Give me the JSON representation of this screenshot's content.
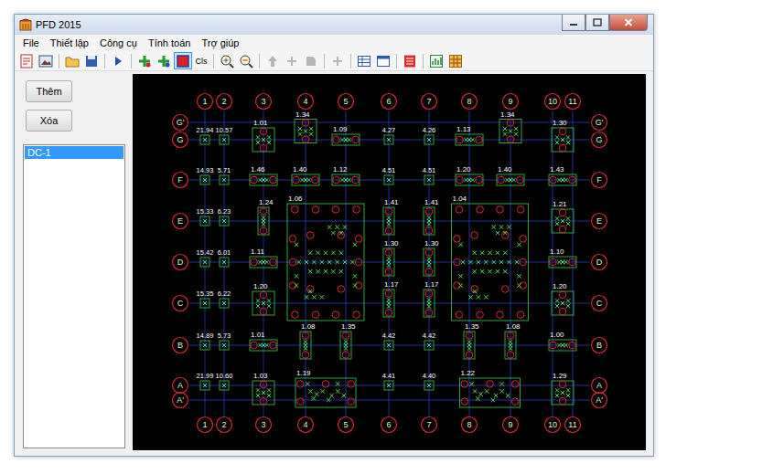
{
  "window": {
    "title": "PFD 2015"
  },
  "menu": [
    {
      "label": "File"
    },
    {
      "label": "Thiết lập"
    },
    {
      "label": "Công cụ"
    },
    {
      "label": "Tính toán"
    },
    {
      "label": "Trợ giúp"
    }
  ],
  "toolbar": [
    {
      "kind": "icon",
      "disabled": false,
      "selected": false
    },
    {
      "kind": "icon",
      "disabled": false,
      "selected": false
    },
    {
      "kind": "separator"
    },
    {
      "kind": "icon",
      "disabled": false,
      "selected": false
    },
    {
      "kind": "icon",
      "disabled": false,
      "selected": false
    },
    {
      "kind": "separator"
    },
    {
      "kind": "icon",
      "disabled": false,
      "selected": false
    },
    {
      "kind": "separator"
    },
    {
      "kind": "icon",
      "disabled": false,
      "selected": false
    },
    {
      "kind": "icon",
      "disabled": false,
      "selected": false
    },
    {
      "kind": "icon",
      "disabled": false,
      "selected": true
    },
    {
      "kind": "text",
      "label": "Cls",
      "disabled": false,
      "selected": false
    },
    {
      "kind": "separator"
    },
    {
      "kind": "icon",
      "disabled": false,
      "selected": false
    },
    {
      "kind": "icon",
      "disabled": false,
      "selected": false
    },
    {
      "kind": "separator"
    },
    {
      "kind": "icon",
      "disabled": true,
      "selected": false
    },
    {
      "kind": "icon",
      "disabled": true,
      "selected": false
    },
    {
      "kind": "icon",
      "disabled": true,
      "selected": false
    },
    {
      "kind": "separator"
    },
    {
      "kind": "icon",
      "disabled": true,
      "selected": false
    },
    {
      "kind": "separator"
    },
    {
      "kind": "icon",
      "disabled": false,
      "selected": false
    },
    {
      "kind": "icon",
      "disabled": false,
      "selected": false
    },
    {
      "kind": "separator"
    },
    {
      "kind": "icon",
      "disabled": false,
      "selected": false
    },
    {
      "kind": "separator"
    },
    {
      "kind": "icon",
      "disabled": false,
      "selected": false
    },
    {
      "kind": "icon",
      "disabled": false,
      "selected": false
    }
  ],
  "sidebar": {
    "buttons": [
      "Thêm",
      "Xóa"
    ],
    "items": [
      {
        "label": "DC-1",
        "selected": true
      }
    ]
  },
  "grid": {
    "columns": [
      {
        "label": "1"
      },
      {
        "label": "2"
      },
      {
        "label": "3"
      },
      {
        "label": "4"
      },
      {
        "label": "5"
      },
      {
        "label": "6"
      },
      {
        "label": "7"
      },
      {
        "label": "8"
      },
      {
        "label": "9"
      },
      {
        "label": "10"
      },
      {
        "label": "11"
      }
    ],
    "rows": [
      {
        "label": "G'"
      },
      {
        "label": "G"
      },
      {
        "label": "F"
      },
      {
        "label": "E"
      },
      {
        "label": "D"
      },
      {
        "label": "C"
      },
      {
        "label": "B"
      },
      {
        "label": "A"
      },
      {
        "label": "A'"
      }
    ]
  },
  "caps": [
    {
      "value": "21.94",
      "cols": [
        "1"
      ],
      "rows": [
        "G"
      ],
      "kind": "single"
    },
    {
      "value": "10.57",
      "cols": [
        "2"
      ],
      "rows": [
        "G"
      ],
      "kind": "single"
    },
    {
      "value": "1.01",
      "cols": [
        "3"
      ],
      "rows": [
        "G"
      ],
      "kind": "quad"
    },
    {
      "value": "1.34",
      "cols": [
        "4"
      ],
      "rows": [
        "G'",
        "G"
      ],
      "kind": "quad"
    },
    {
      "value": "1.09",
      "cols": [
        "5"
      ],
      "rows": [
        "G"
      ],
      "kind": "pair-h"
    },
    {
      "value": "4.27",
      "cols": [
        "6"
      ],
      "rows": [
        "G"
      ],
      "kind": "single"
    },
    {
      "value": "4.26",
      "cols": [
        "7"
      ],
      "rows": [
        "G"
      ],
      "kind": "single"
    },
    {
      "value": "1.13",
      "cols": [
        "8"
      ],
      "rows": [
        "G"
      ],
      "kind": "pair-h"
    },
    {
      "value": "1.34",
      "cols": [
        "9"
      ],
      "rows": [
        "G'",
        "G"
      ],
      "kind": "quad"
    },
    {
      "value": "1.30",
      "cols": [
        "10",
        "11"
      ],
      "rows": [
        "G"
      ],
      "kind": "quad"
    },
    {
      "value": "14.93",
      "cols": [
        "1"
      ],
      "rows": [
        "F"
      ],
      "kind": "single"
    },
    {
      "value": "5.71",
      "cols": [
        "2"
      ],
      "rows": [
        "F"
      ],
      "kind": "single"
    },
    {
      "value": "1.46",
      "cols": [
        "3"
      ],
      "rows": [
        "F"
      ],
      "kind": "pair-h"
    },
    {
      "value": "1.40",
      "cols": [
        "4"
      ],
      "rows": [
        "F"
      ],
      "kind": "pair-h"
    },
    {
      "value": "1.12",
      "cols": [
        "5"
      ],
      "rows": [
        "F"
      ],
      "kind": "pair-h"
    },
    {
      "value": "4.51",
      "cols": [
        "6"
      ],
      "rows": [
        "F"
      ],
      "kind": "single"
    },
    {
      "value": "4.51",
      "cols": [
        "7"
      ],
      "rows": [
        "F"
      ],
      "kind": "single"
    },
    {
      "value": "1.20",
      "cols": [
        "8"
      ],
      "rows": [
        "F"
      ],
      "kind": "pair-h"
    },
    {
      "value": "1.40",
      "cols": [
        "9"
      ],
      "rows": [
        "F"
      ],
      "kind": "pair-h"
    },
    {
      "value": "1.43",
      "cols": [
        "10",
        "11"
      ],
      "rows": [
        "F"
      ],
      "kind": "pair-h"
    },
    {
      "value": "15.33",
      "cols": [
        "1"
      ],
      "rows": [
        "E"
      ],
      "kind": "single"
    },
    {
      "value": "6.23",
      "cols": [
        "2"
      ],
      "rows": [
        "E"
      ],
      "kind": "single"
    },
    {
      "value": "1.24",
      "cols": [
        "3"
      ],
      "rows": [
        "E"
      ],
      "kind": "pair-v"
    },
    {
      "value": "1.06",
      "cols": [
        "4",
        "5"
      ],
      "rows": [
        "E",
        "C"
      ],
      "kind": "big"
    },
    {
      "value": "1.41",
      "cols": [
        "6"
      ],
      "rows": [
        "E"
      ],
      "kind": "pair-v"
    },
    {
      "value": "1.41",
      "cols": [
        "7"
      ],
      "rows": [
        "E"
      ],
      "kind": "pair-v"
    },
    {
      "value": "1.04",
      "cols": [
        "8",
        "9"
      ],
      "rows": [
        "E",
        "C"
      ],
      "kind": "big"
    },
    {
      "value": "1.21",
      "cols": [
        "10",
        "11"
      ],
      "rows": [
        "E"
      ],
      "kind": "quad"
    },
    {
      "value": "15.42",
      "cols": [
        "1"
      ],
      "rows": [
        "D"
      ],
      "kind": "single"
    },
    {
      "value": "6.01",
      "cols": [
        "2"
      ],
      "rows": [
        "D"
      ],
      "kind": "single"
    },
    {
      "value": "1.11",
      "cols": [
        "3"
      ],
      "rows": [
        "D"
      ],
      "kind": "pair-h"
    },
    {
      "value": "1.30",
      "cols": [
        "6"
      ],
      "rows": [
        "D"
      ],
      "kind": "pair-v"
    },
    {
      "value": "1.30",
      "cols": [
        "7"
      ],
      "rows": [
        "D"
      ],
      "kind": "pair-v"
    },
    {
      "value": "1.10",
      "cols": [
        "10",
        "11"
      ],
      "rows": [
        "D"
      ],
      "kind": "pair-h"
    },
    {
      "value": "15.35",
      "cols": [
        "1"
      ],
      "rows": [
        "C"
      ],
      "kind": "single"
    },
    {
      "value": "6.22",
      "cols": [
        "2"
      ],
      "rows": [
        "C"
      ],
      "kind": "single"
    },
    {
      "value": "1.20",
      "cols": [
        "3"
      ],
      "rows": [
        "C"
      ],
      "kind": "quad"
    },
    {
      "value": "1.17",
      "cols": [
        "6"
      ],
      "rows": [
        "C"
      ],
      "kind": "pair-v"
    },
    {
      "value": "1.17",
      "cols": [
        "7"
      ],
      "rows": [
        "C"
      ],
      "kind": "pair-v"
    },
    {
      "value": "1.20",
      "cols": [
        "10",
        "11"
      ],
      "rows": [
        "C"
      ],
      "kind": "quad"
    },
    {
      "value": "14.89",
      "cols": [
        "1"
      ],
      "rows": [
        "B"
      ],
      "kind": "single"
    },
    {
      "value": "5.73",
      "cols": [
        "2"
      ],
      "rows": [
        "B"
      ],
      "kind": "single"
    },
    {
      "value": "1.01",
      "cols": [
        "3"
      ],
      "rows": [
        "B"
      ],
      "kind": "pair-h"
    },
    {
      "value": "1.08",
      "cols": [
        "4"
      ],
      "rows": [
        "B"
      ],
      "kind": "pair-v"
    },
    {
      "value": "1.35",
      "cols": [
        "5"
      ],
      "rows": [
        "B"
      ],
      "kind": "pair-v"
    },
    {
      "value": "4.42",
      "cols": [
        "6"
      ],
      "rows": [
        "B"
      ],
      "kind": "single"
    },
    {
      "value": "4.42",
      "cols": [
        "7"
      ],
      "rows": [
        "B"
      ],
      "kind": "single"
    },
    {
      "value": "1.35",
      "cols": [
        "8"
      ],
      "rows": [
        "B"
      ],
      "kind": "pair-v"
    },
    {
      "value": "1.08",
      "cols": [
        "9"
      ],
      "rows": [
        "B"
      ],
      "kind": "pair-v"
    },
    {
      "value": "1.00",
      "cols": [
        "10",
        "11"
      ],
      "rows": [
        "B"
      ],
      "kind": "pair-h"
    },
    {
      "value": "21.99",
      "cols": [
        "1"
      ],
      "rows": [
        "A"
      ],
      "kind": "single"
    },
    {
      "value": "10.60",
      "cols": [
        "2"
      ],
      "rows": [
        "A"
      ],
      "kind": "single"
    },
    {
      "value": "1.03",
      "cols": [
        "3"
      ],
      "rows": [
        "A",
        "A'"
      ],
      "kind": "quad"
    },
    {
      "value": "1.19",
      "cols": [
        "4",
        "5"
      ],
      "rows": [
        "A",
        "A'"
      ],
      "kind": "rect"
    },
    {
      "value": "4.41",
      "cols": [
        "6"
      ],
      "rows": [
        "A"
      ],
      "kind": "single"
    },
    {
      "value": "4.40",
      "cols": [
        "7"
      ],
      "rows": [
        "A"
      ],
      "kind": "single"
    },
    {
      "value": "1.22",
      "cols": [
        "8",
        "9"
      ],
      "rows": [
        "A",
        "A'"
      ],
      "kind": "rect"
    },
    {
      "value": "1.29",
      "cols": [
        "10",
        "11"
      ],
      "rows": [
        "A",
        "A'"
      ],
      "kind": "quad"
    }
  ]
}
